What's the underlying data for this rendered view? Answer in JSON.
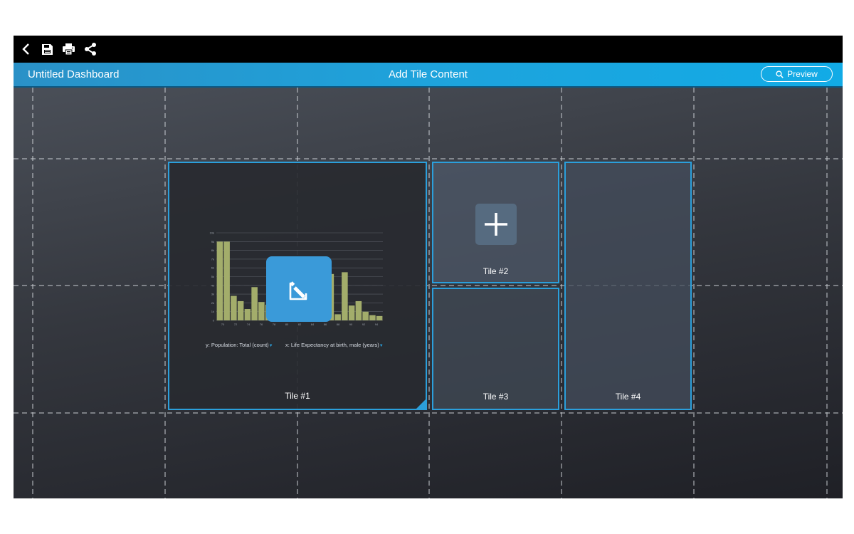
{
  "toolbar": {
    "icons": [
      "back-icon",
      "save-icon",
      "print-icon",
      "share-icon"
    ]
  },
  "header": {
    "title": "Untitled Dashboard",
    "center_title": "Add Tile Content",
    "preview_label": "Preview"
  },
  "tiles": {
    "tile1": {
      "label": "Tile #1",
      "y_axis_label": "y: Population: Total (count)",
      "x_axis_label": "x: Life Expectancy at birth, male (years)"
    },
    "tile2": {
      "label": "Tile #2"
    },
    "tile3": {
      "label": "Tile #3"
    },
    "tile4": {
      "label": "Tile #4"
    }
  },
  "chart_data": {
    "type": "bar",
    "categories": [
      "70",
      "",
      "72",
      "",
      "74",
      "",
      "76",
      "",
      "78",
      "",
      "80",
      "",
      "82",
      "",
      "84",
      "",
      "86",
      "",
      "88",
      "",
      "90",
      "",
      "92",
      "",
      "94"
    ],
    "y_ticks": [
      "0",
      "1k",
      "2k",
      "3k",
      "4k",
      "5k",
      "6k",
      "7k",
      "8k",
      "9k",
      "10k"
    ],
    "x_ticks": [
      "70",
      "72",
      "74",
      "76",
      "78",
      "80",
      "82",
      "84",
      "86",
      "88",
      "90",
      "92",
      "94"
    ],
    "values": [
      9000,
      9000,
      2800,
      2200,
      1300,
      3800,
      2100,
      1800,
      1500,
      1200,
      1600,
      1400,
      1800,
      2000,
      2200,
      1200,
      5300,
      700,
      5500,
      1700,
      2200,
      1000,
      600,
      500
    ],
    "ylim": [
      0,
      10000
    ],
    "bar_color": "#a3ad6b",
    "grid": true
  },
  "colors": {
    "accent": "#2b9fdb",
    "header_gradient_start": "#2a91c7",
    "header_gradient_end": "#12abe6",
    "edit_button": "#3a9ad9",
    "add_button": "#566b80"
  }
}
